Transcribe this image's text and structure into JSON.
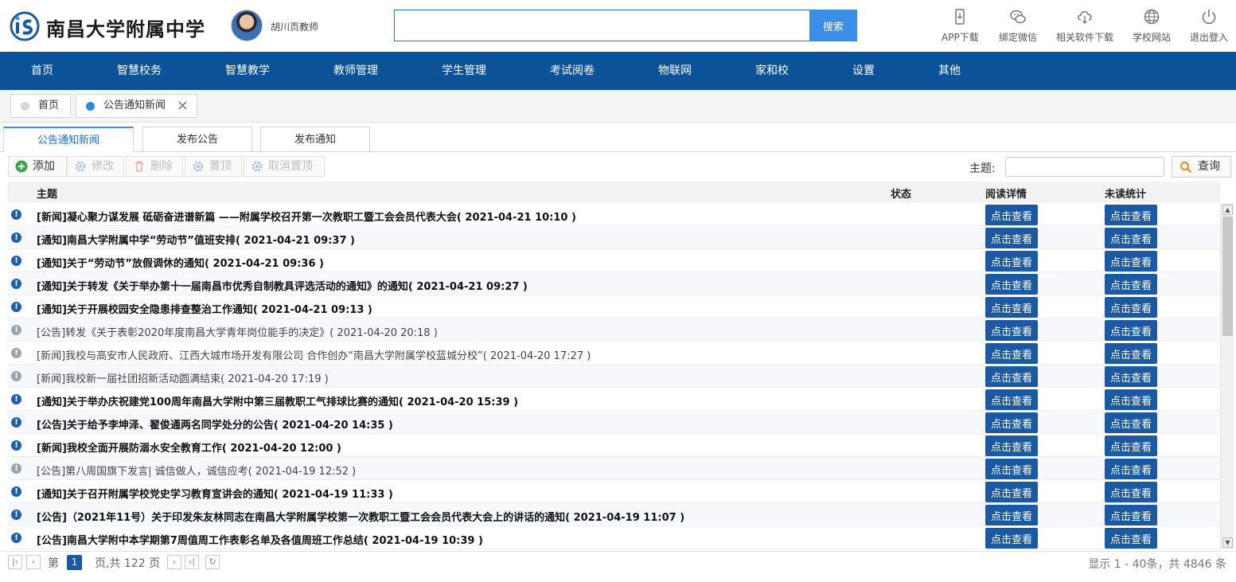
{
  "header": {
    "school_name": "南昌大学附属中学",
    "user_name": "胡川页教师",
    "search": {
      "value": "",
      "placeholder": "",
      "button": "搜索"
    },
    "tools": [
      {
        "label": "APP下载",
        "icon": "mobile-icon"
      },
      {
        "label": "绑定微信",
        "icon": "wechat-icon"
      },
      {
        "label": "相关软件下载",
        "icon": "cloud-download-icon"
      },
      {
        "label": "学校网站",
        "icon": "globe-icon"
      },
      {
        "label": "退出登入",
        "icon": "power-icon"
      }
    ]
  },
  "nav": [
    "首页",
    "智慧校务",
    "智慧教学",
    "教师管理",
    "学生管理",
    "考试阅卷",
    "物联网",
    "家和校",
    "设置",
    "其他"
  ],
  "page_tabs": [
    {
      "label": "首页",
      "active": false
    },
    {
      "label": "公告通知新闻",
      "active": true,
      "closable": true
    }
  ],
  "sub_tabs": [
    "公告通知新闻",
    "发布公告",
    "发布通知"
  ],
  "toolbar": {
    "add": "添加",
    "edit": "修改",
    "delete": "删除",
    "pin": "置顶",
    "unpin": "取消置顶",
    "theme_label": "主题:",
    "theme_value": "",
    "query": "查询"
  },
  "columns": {
    "title": "主题",
    "status": "状态",
    "read_detail": "阅读详情",
    "unread_stats": "未读统计"
  },
  "view_label": "点击查看",
  "rows": [
    {
      "title": "[新闻]凝心聚力谋发展 砥砺奋进谱新篇 ——附属学校召开第一次教职工暨工会会员代表大会( 2021-04-21 10:10 )",
      "read": false
    },
    {
      "title": "[通知]南昌大学附属中学“劳动节”值班安排( 2021-04-21 09:37 )",
      "read": false
    },
    {
      "title": "[通知]关于“劳动节”放假调休的通知( 2021-04-21 09:36 )",
      "read": false
    },
    {
      "title": "[通知]关于转发《关于举办第十一届南昌市优秀自制教具评选活动的通知》的通知( 2021-04-21 09:27 )",
      "read": false
    },
    {
      "title": "[通知]关于开展校园安全隐患排查整治工作通知( 2021-04-21 09:13 )",
      "read": false
    },
    {
      "title": "[公告]转发《关于表彰2020年度南昌大学青年岗位能手的决定》( 2021-04-20 20:18 )",
      "read": true
    },
    {
      "title": "[新闻]我校与高安市人民政府、江西大城市场开发有限公司 合作创办“南昌大学附属学校蓝城分校”( 2021-04-20 17:27 )",
      "read": true
    },
    {
      "title": "[新闻]我校新一届社团招新活动圆满结束( 2021-04-20 17:19 )",
      "read": true
    },
    {
      "title": "[通知]关于举办庆祝建党100周年南昌大学附中第三届教职工气排球比赛的通知( 2021-04-20 15:39 )",
      "read": false
    },
    {
      "title": "[公告]关于给予李坤泽、翟俊通两名同学处分的公告( 2021-04-20 14:35 )",
      "read": false
    },
    {
      "title": "[新闻]我校全面开展防溺水安全教育工作( 2021-04-20 12:00 )",
      "read": false
    },
    {
      "title": "[公告]第八周国旗下发言| 诚信做人，诚信应考( 2021-04-19 12:52 )",
      "read": true
    },
    {
      "title": "[通知]关于召开附属学校党史学习教育宣讲会的通知( 2021-04-19 11:33 )",
      "read": false
    },
    {
      "title": "[公告]（2021年11号）关于印发朱友林同志在南昌大学附属学校第一次教职工暨工会会员代表大会上的讲话的通知( 2021-04-19 11:07 )",
      "read": false
    },
    {
      "title": "[公告]南昌大学附中本学期第7周值周工作表彰名单及各值周班工作总结( 2021-04-19 10:39 )",
      "read": false
    }
  ],
  "pager": {
    "page_prefix": "第",
    "current_page": "1",
    "page_suffix": "页,共 122 页",
    "summary": "显示 1 - 40条，共 4846 条"
  }
}
